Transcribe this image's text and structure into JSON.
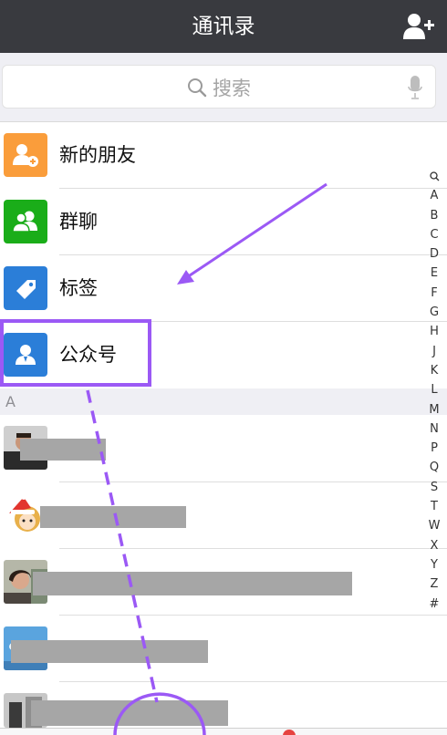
{
  "header": {
    "title": "通讯录",
    "add_icon": "add-contact-icon"
  },
  "search": {
    "placeholder": "搜索",
    "icon": "search-icon",
    "voice_icon": "microphone-icon"
  },
  "menu": [
    {
      "label": "新的朋友",
      "color": "#fa9d3b",
      "icon": "new-friend-icon"
    },
    {
      "label": "群聊",
      "color": "#1aad19",
      "icon": "group-chat-icon"
    },
    {
      "label": "标签",
      "color": "#2b7ed8",
      "icon": "tag-icon"
    },
    {
      "label": "公众号",
      "color": "#2b7ed8",
      "icon": "official-account-icon"
    }
  ],
  "section": {
    "letter": "A"
  },
  "index": [
    "Q",
    "A",
    "B",
    "C",
    "D",
    "E",
    "F",
    "G",
    "H",
    "J",
    "K",
    "L",
    "M",
    "N",
    "P",
    "Q",
    "S",
    "T",
    "W",
    "X",
    "Y",
    "Z",
    "#"
  ],
  "colors": {
    "navbar": "#393a3f",
    "annotation": "#9b59f5",
    "redaction": "#a6a6a6"
  }
}
